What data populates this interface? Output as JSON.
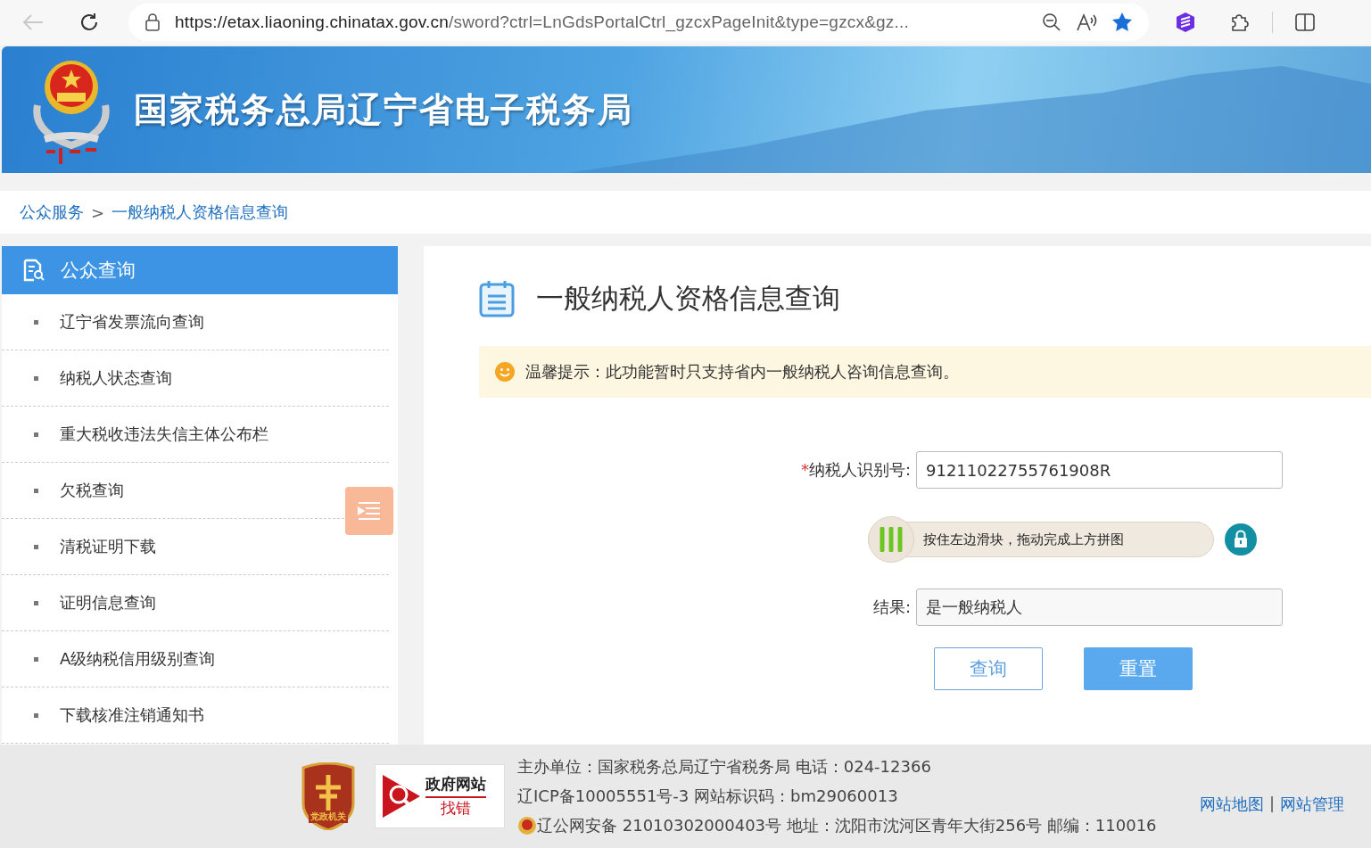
{
  "browser": {
    "url_host": "https://etax.liaoning.chinatax.gov.cn",
    "url_path": "/sword?ctrl=LnGdsPortalCtrl_gzcxPageInit&type=gzcx&gz..."
  },
  "header": {
    "title": "国家税务总局辽宁省电子税务局"
  },
  "breadcrumb": [
    {
      "label": "公众服务"
    },
    {
      "label": "一般纳税人资格信息查询"
    }
  ],
  "breadcrumb_separator": ">",
  "sidebar": {
    "title": "公众查询",
    "items": [
      {
        "label": "辽宁省发票流向查询",
        "selected": false
      },
      {
        "label": "纳税人状态查询",
        "selected": false
      },
      {
        "label": "重大税收违法失信主体公布栏",
        "selected": false
      },
      {
        "label": "欠税查询",
        "selected": false
      },
      {
        "label": "清税证明下载",
        "selected": false
      },
      {
        "label": "证明信息查询",
        "selected": false
      },
      {
        "label": "A级纳税信用级别查询",
        "selected": false
      },
      {
        "label": "下载核准注销通知书",
        "selected": false
      }
    ]
  },
  "main": {
    "title": "一般纳税人资格信息查询",
    "notice": "温馨提示：此功能暂时只支持省内一般纳税人咨询信息查询。",
    "taxpayer_id": {
      "required_mark": "*",
      "label": "纳税人识别号:",
      "value": "91211022755761908R"
    },
    "slider": {
      "hint": "按住左边滑块，拖动完成上方拼图",
      "level": 0
    },
    "result": {
      "label": "结果:",
      "value": "是一般纳税人"
    },
    "buttons": [
      {
        "label": "查询",
        "kind": "outline"
      },
      {
        "label": "重置",
        "kind": "primary"
      }
    ]
  },
  "footer": {
    "badge": "党政机关",
    "report_badge": {
      "line1": "政府网站",
      "line2": "找错"
    },
    "lines": [
      "主办单位：国家税务总局辽宁省税务局 电话：024-12366",
      "辽ICP备10005551号-3 网站标识码：bm29060013",
      "辽公网安备 21010302000403号 地址：沈阳市沈河区青年大街256号 邮编：110016"
    ],
    "links": [
      "网站地图",
      "网站管理"
    ],
    "link_separator": "|"
  }
}
